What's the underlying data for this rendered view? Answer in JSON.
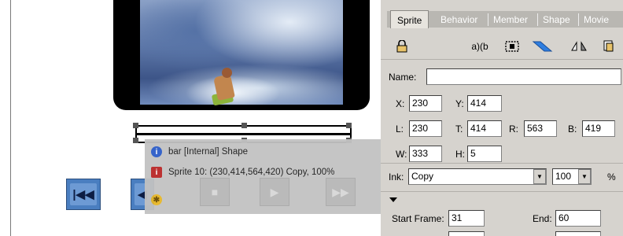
{
  "stage": {
    "info": {
      "sprite_name": "bar [Internal] Shape",
      "sprite_details": "Sprite 10: (230,414,564,420) Copy, 100%"
    },
    "controls": {
      "rewind_icon": "rewind-icon",
      "step_back_icon": "step-back-icon",
      "stop_icon": "stop-icon",
      "play_icon": "play-icon",
      "fast_forward_icon": "fast-forward-icon"
    }
  },
  "inspector": {
    "tabs": [
      "Sprite",
      "Behavior",
      "Member",
      "Shape",
      "Movie"
    ],
    "active_tab": "Sprite",
    "toolbar": {
      "lock_icon": "lock-icon",
      "ab_label": "a)(b",
      "editable_icon": "editable-icon",
      "moveable_icon": "moveable-icon",
      "flip_icon": "flip-icon",
      "trails_icon": "trails-icon"
    },
    "name": {
      "label": "Name:",
      "value": ""
    },
    "x": {
      "label": "X:",
      "value": "230"
    },
    "y": {
      "label": "Y:",
      "value": "414"
    },
    "l": {
      "label": "L:",
      "value": "230"
    },
    "t": {
      "label": "T:",
      "value": "414"
    },
    "r": {
      "label": "R:",
      "value": "563"
    },
    "b": {
      "label": "B:",
      "value": "419"
    },
    "w": {
      "label": "W:",
      "value": "333"
    },
    "h": {
      "label": "H:",
      "value": "5"
    },
    "ink": {
      "label": "Ink:",
      "value": "Copy"
    },
    "blend": {
      "value": "100",
      "unit": "%"
    },
    "start_frame": {
      "label": "Start Frame:",
      "value": "31"
    },
    "end_frame": {
      "label": "End:",
      "value": "60"
    }
  }
}
